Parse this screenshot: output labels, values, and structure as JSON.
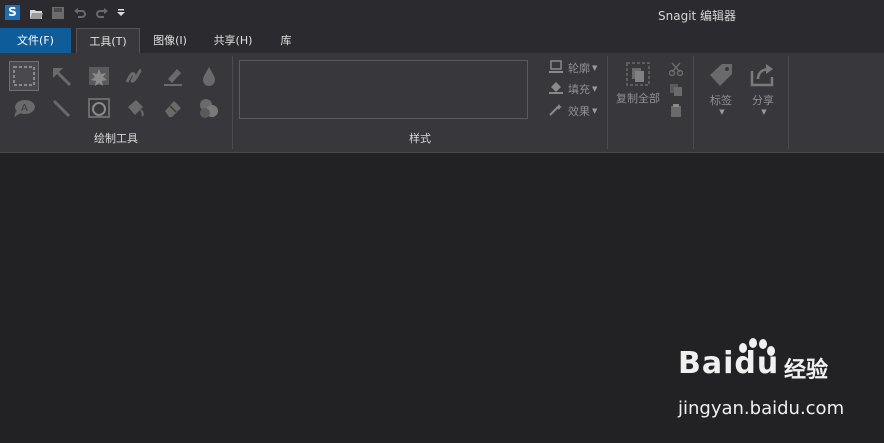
{
  "app": {
    "logo_letter": "S",
    "window_title": "Snagit 编辑器"
  },
  "quick_access": [
    "open-icon",
    "save-icon",
    "undo-icon",
    "redo-icon",
    "customize-icon"
  ],
  "tabs": [
    {
      "label": "文件(F)"
    },
    {
      "label": "工具(T)"
    },
    {
      "label": "图像(I)"
    },
    {
      "label": "共享(H)"
    },
    {
      "label": "库"
    }
  ],
  "groups": {
    "drawing_tools": {
      "label": "绘制工具"
    },
    "style": {
      "label": "样式"
    }
  },
  "style_buttons": [
    {
      "label": "轮廓",
      "icon": "outline-icon"
    },
    {
      "label": "填充",
      "icon": "fill-icon"
    },
    {
      "label": "效果",
      "icon": "effects-icon"
    }
  ],
  "clipboard": {
    "copy_all_label": "复制全部"
  },
  "tag": {
    "label": "标签"
  },
  "share": {
    "label": "分享"
  },
  "watermark": {
    "brand": "Baidu",
    "suffix": "经验",
    "url": "jingyan.baidu.com"
  },
  "colors": {
    "file_tab": "#0e5c9a",
    "background": "#222124",
    "ribbon": "#38373b"
  }
}
